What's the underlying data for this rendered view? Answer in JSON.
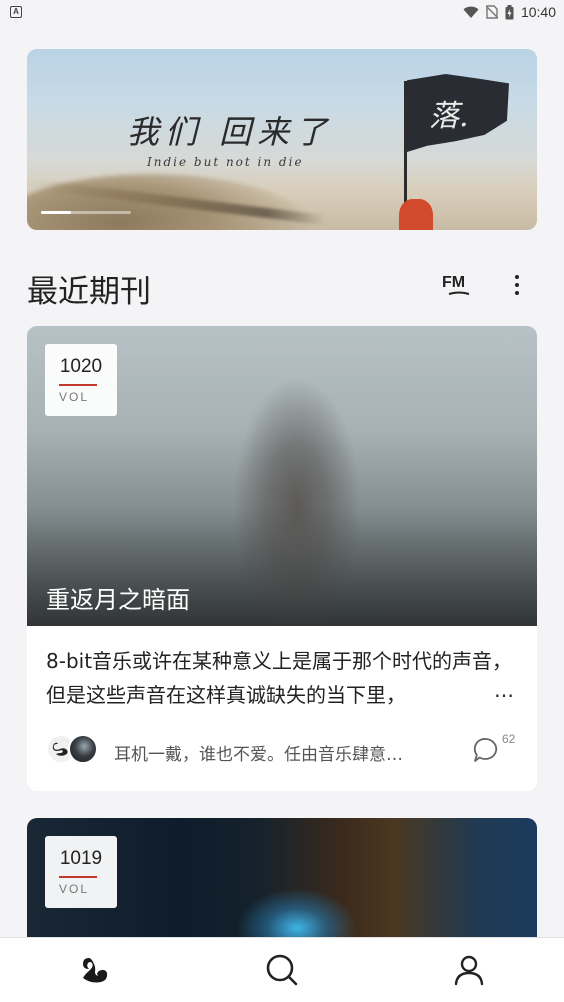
{
  "status_bar": {
    "left_indicator": "A",
    "time": "10:40",
    "icons": [
      "wifi-icon",
      "no-sim-icon",
      "battery-icon"
    ]
  },
  "banner": {
    "title": "我们 回来了",
    "subtitle": "Indie but not in die",
    "flag_text": "落.",
    "carousel_position": 1,
    "carousel_count": 3
  },
  "section": {
    "title": "最近期刊",
    "fm_label": "FM",
    "more_icon": "more-vertical-icon"
  },
  "issues": [
    {
      "vol_number": "1020",
      "vol_label": "VOL",
      "title": "重返月之暗面",
      "description": "8-bit音乐或许在某种意义上是属于那个时代的声音，但是这些声音在这样真诚缺失的当下里，",
      "meta_text": "耳机一戴，谁也不爱。任由音乐肆意…",
      "comment_count": "62"
    },
    {
      "vol_number": "1019",
      "vol_label": "VOL"
    }
  ],
  "tabbar": {
    "items": [
      "home-swan-icon",
      "search-icon",
      "profile-icon"
    ],
    "active": "home-swan-icon"
  },
  "colors": {
    "background": "#f4f4f6",
    "accent_red": "#c0392b",
    "text_primary": "#222222"
  }
}
